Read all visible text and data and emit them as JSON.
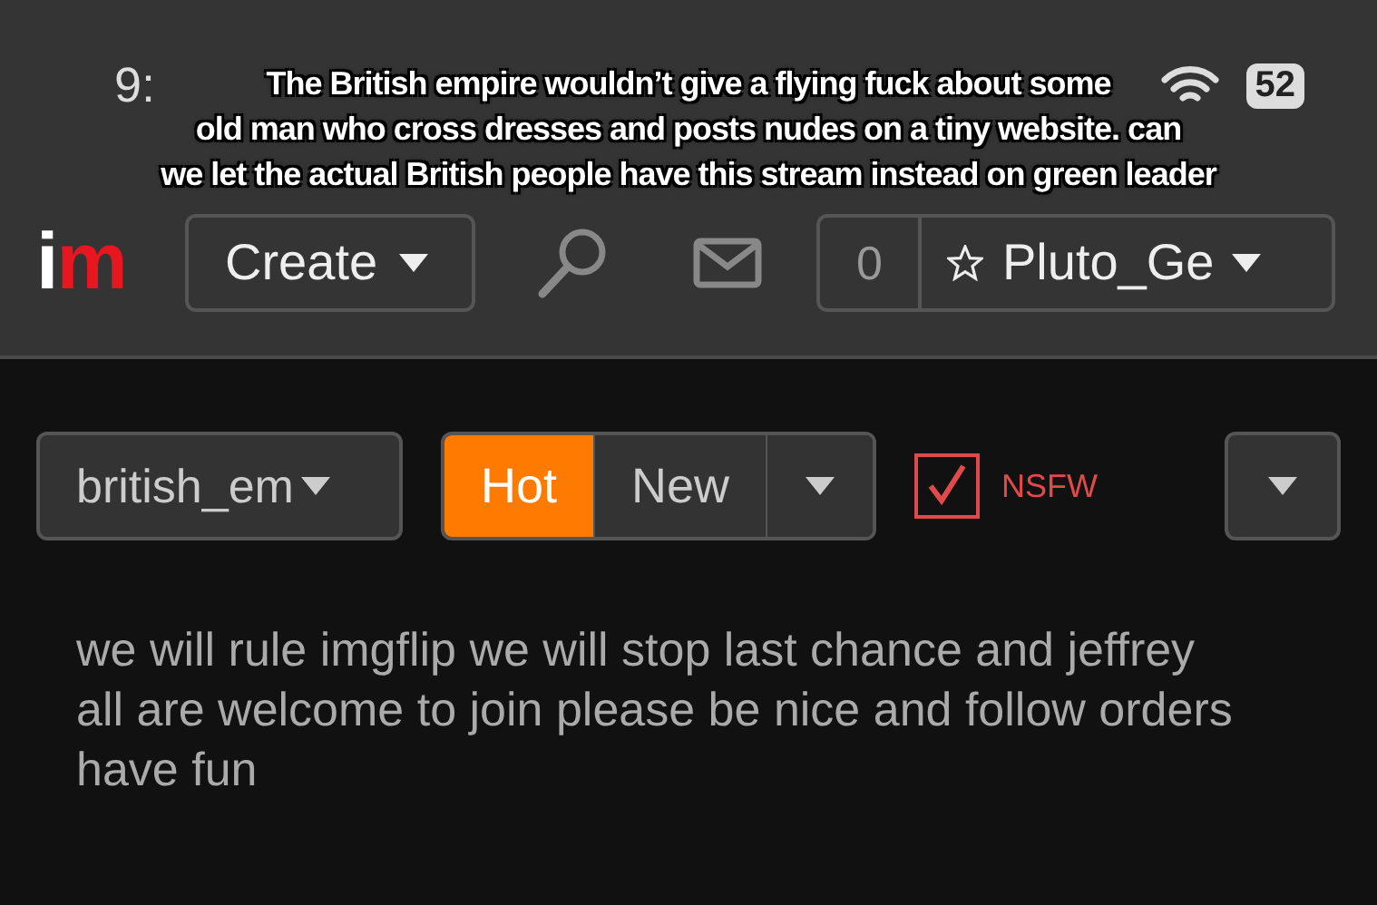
{
  "status_bar": {
    "time": "9:",
    "battery": "52"
  },
  "caption": [
    "The British empire wouldn’t give a flying fuck about some",
    "old man who cross dresses and posts nudes on a tiny website. can",
    "we let the actual British people have this stream instead on green leader"
  ],
  "nav": {
    "logo": "im",
    "create_label": "Create",
    "points": "0",
    "username": "Pluto_Ge"
  },
  "stream_select": {
    "value": "british_em"
  },
  "sort_tabs": [
    {
      "label": "Hot",
      "selected": true
    },
    {
      "label": "New",
      "selected": false
    }
  ],
  "nsfw": {
    "label": "NSFW",
    "checked": true
  },
  "description": "we will rule imgflip we will stop last chance and jeffrey all are welcome to join please be nice and follow orders have fun"
}
